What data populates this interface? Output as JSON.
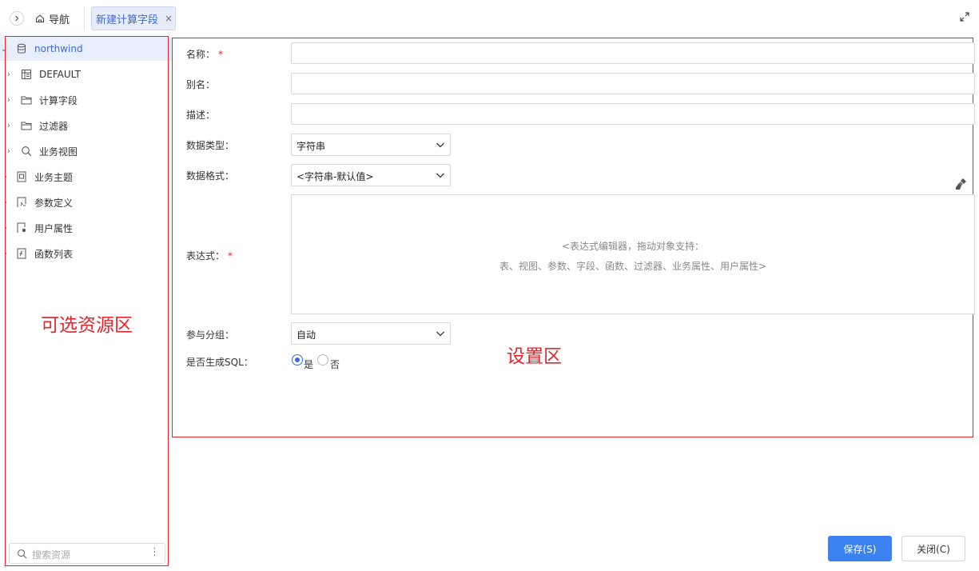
{
  "topbar": {
    "nav_label": "导航",
    "active_tab_label": "新建计算字段",
    "close_symbol": "×"
  },
  "tree": {
    "items": [
      {
        "label": "northwind",
        "icon": "database-icon"
      },
      {
        "label": "DEFAULT",
        "icon": "schema-icon"
      },
      {
        "label": "计算字段",
        "icon": "folder-icon"
      },
      {
        "label": "过滤器",
        "icon": "folder-icon"
      },
      {
        "label": "业务视图",
        "icon": "search-icon"
      },
      {
        "label": "业务主题",
        "icon": "subject-icon"
      },
      {
        "label": "参数定义",
        "icon": "parameter-icon"
      },
      {
        "label": "用户属性",
        "icon": "user-attribute-icon"
      },
      {
        "label": "函数列表",
        "icon": "function-icon"
      }
    ],
    "search_placeholder": "搜索资源"
  },
  "annotations": {
    "left_region": "可选资源区",
    "right_region": "设置区"
  },
  "form": {
    "name_label": "名称：",
    "alias_label": "别名：",
    "description_label": "描述：",
    "data_type_label": "数据类型：",
    "data_type_value": "字符串",
    "data_format_label": "数据格式：",
    "data_format_value": "<字符串-默认值>",
    "expression_label": "表达式：",
    "expression_hint_line1": "<表达式编辑器，拖动对象支持：",
    "expression_hint_line2": "表、视图、参数、字段、函数、过滤器、业务属性、用户属性>",
    "grouping_label": "参与分组：",
    "grouping_value": "自动",
    "generate_sql_label": "是否生成SQL：",
    "yes_label": "是",
    "no_label": "否",
    "generate_sql_selected": "是",
    "required_mark": "*"
  },
  "buttons": {
    "save": "保存(S)",
    "close": "关闭(C)"
  },
  "colors": {
    "accent": "#3b82f0",
    "annotation": "#e5252b",
    "selected_bg": "#e9eefc"
  }
}
